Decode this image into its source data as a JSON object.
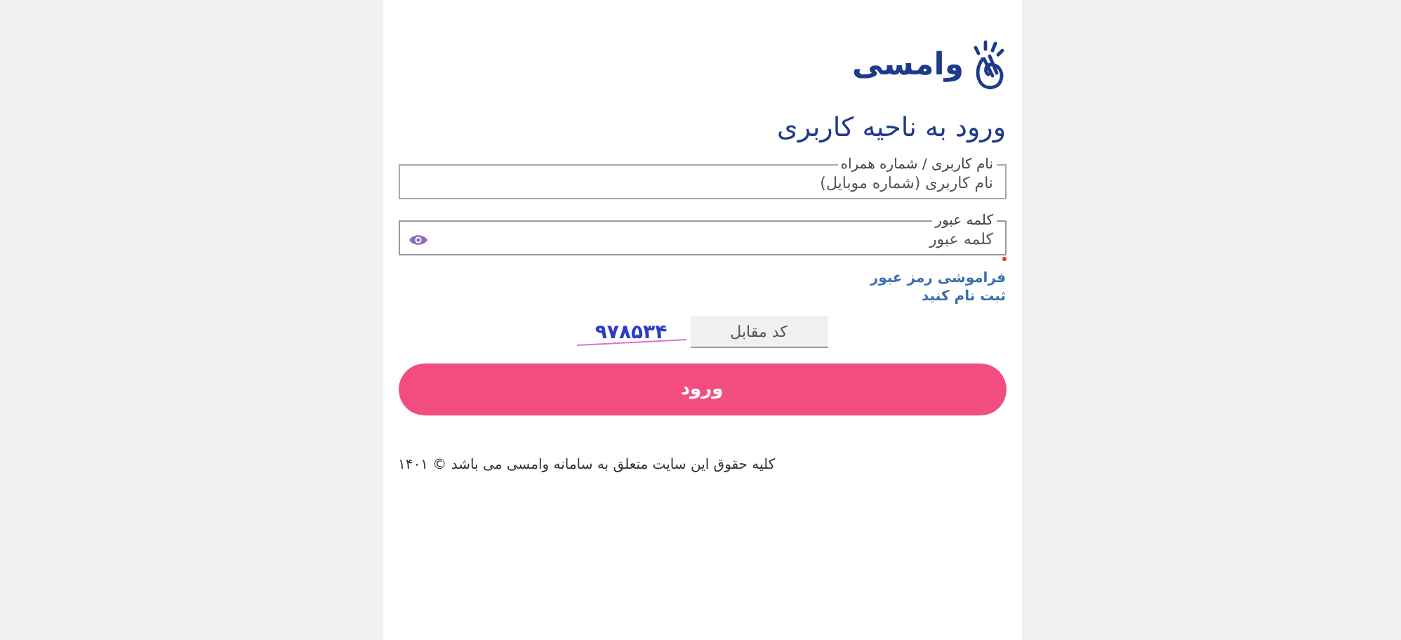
{
  "logo": {
    "brand": "وامسی"
  },
  "title": "ورود به ناحیه کاربری",
  "fields": [
    {
      "kind": "text",
      "label": "نام کاربری / شماره همراه",
      "placeholder": "نام کاربری (شماره موبایل)",
      "required": false
    },
    {
      "kind": "password",
      "label": "کلمه عبور",
      "placeholder": "کلمه عبور",
      "required": true
    }
  ],
  "links": [
    "فراموشی رمز عبور",
    "ثبت نام کنید"
  ],
  "captcha": {
    "code": "۹۷۸۵۳۴",
    "placeholder": "کد مقابل"
  },
  "submit": "ورود",
  "footer": "کلیه حقوق این سایت متعلق به سامانه وامسی می باشد © ۱۴۰۱"
}
